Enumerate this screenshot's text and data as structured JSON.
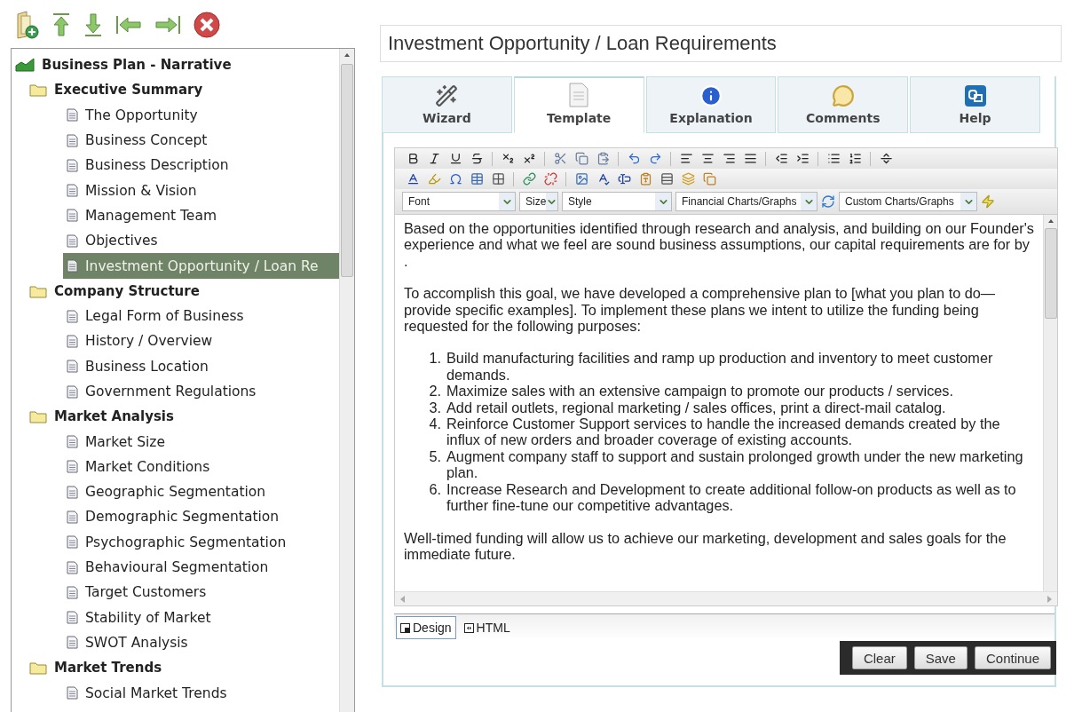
{
  "tree": {
    "label": "Business Plan - Narrative",
    "children": [
      {
        "label": "Executive Summary",
        "children": [
          {
            "label": "The Opportunity",
            "selected": false
          },
          {
            "label": "Business Concept",
            "selected": false
          },
          {
            "label": "Business Description",
            "selected": false
          },
          {
            "label": "Mission & Vision",
            "selected": false
          },
          {
            "label": "Management Team",
            "selected": false
          },
          {
            "label": "Objectives",
            "selected": false
          },
          {
            "label": "Investment Opportunity / Loan Re",
            "selected": true
          }
        ]
      },
      {
        "label": "Company Structure",
        "children": [
          {
            "label": "Legal Form of Business",
            "selected": false
          },
          {
            "label": "History / Overview",
            "selected": false
          },
          {
            "label": "Business Location",
            "selected": false
          },
          {
            "label": "Government Regulations",
            "selected": false
          }
        ]
      },
      {
        "label": "Market Analysis",
        "children": [
          {
            "label": "Market Size",
            "selected": false
          },
          {
            "label": "Market Conditions",
            "selected": false
          },
          {
            "label": "Geographic Segmentation",
            "selected": false
          },
          {
            "label": "Demographic Segmentation",
            "selected": false
          },
          {
            "label": "Psychographic Segmentation",
            "selected": false
          },
          {
            "label": "Behavioural Segmentation",
            "selected": false
          },
          {
            "label": "Target Customers",
            "selected": false
          },
          {
            "label": "Stability of Market",
            "selected": false
          },
          {
            "label": "SWOT Analysis",
            "selected": false
          }
        ]
      },
      {
        "label": "Market Trends",
        "children": [
          {
            "label": "Social Market Trends",
            "selected": false
          }
        ]
      }
    ]
  },
  "title": "Investment Opportunity / Loan Requirements",
  "tabs": [
    {
      "label": "Wizard",
      "selected": false
    },
    {
      "label": "Template",
      "selected": true
    },
    {
      "label": "Explanation",
      "selected": false
    },
    {
      "label": "Comments",
      "selected": false
    },
    {
      "label": "Help",
      "selected": false
    }
  ],
  "editor": {
    "dropdowns": [
      {
        "label": "Font"
      },
      {
        "label": "Size"
      },
      {
        "label": "Style"
      },
      {
        "label": "Financial Charts/Graphs"
      },
      {
        "label": "Custom Charts/Graphs"
      }
    ],
    "content": [
      {
        "kind": "paragraph",
        "text": "Based on the opportunities identified through research and analysis, and building on our Founder's experience and what we feel are sound business assumptions, our capital requirements are for by ."
      },
      {
        "kind": "paragraph",
        "text": "To accomplish this goal, we have developed a comprehensive plan to [what you plan to do—provide specific examples]. To implement these plans we intent to utilize the funding being requested for the following purposes:"
      },
      {
        "kind": "list",
        "items": [
          {
            "number": "1.",
            "text": "Build manufacturing facilities and ramp up production and inventory to meet customer demands."
          },
          {
            "number": "2.",
            "text": "Maximize sales with an extensive campaign to promote our products / services."
          },
          {
            "number": "3.",
            "text": "Add retail outlets, regional marketing / sales offices, print a direct-mail catalog."
          },
          {
            "number": "4.",
            "text": "Reinforce Customer Support services to handle the increased demands created by the influx of new orders and broader coverage of existing accounts."
          },
          {
            "number": "5.",
            "text": "Augment company staff to support and sustain prolonged growth under the new marketing plan."
          },
          {
            "number": "6.",
            "text": "Increase Research and Development to create additional follow-on products as well as to further fine-tune our competitive advantages."
          }
        ]
      },
      {
        "kind": "paragraph",
        "text": "Well-timed funding will allow us to achieve our marketing, development and sales goals for the immediate future."
      }
    ],
    "modes": [
      {
        "label": "Design",
        "selected": true
      },
      {
        "label": "HTML",
        "selected": false
      }
    ]
  },
  "buttons": [
    "Clear",
    "Save",
    "Continue"
  ]
}
